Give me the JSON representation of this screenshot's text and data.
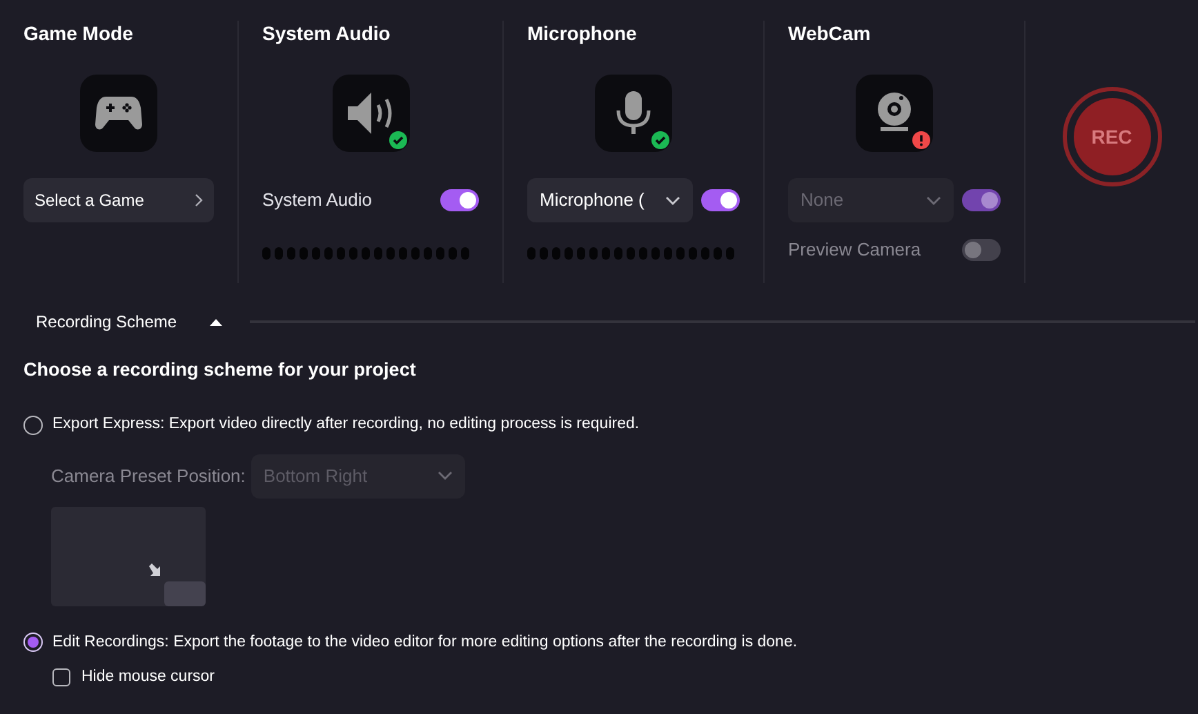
{
  "sources": [
    {
      "kind": "game",
      "title": "Game Mode",
      "button": "Select a Game"
    },
    {
      "kind": "audio",
      "title": "System Audio",
      "ready": true,
      "label": "System Audio",
      "on": true
    },
    {
      "kind": "mic",
      "title": "Microphone",
      "ready": true,
      "dropdown": "Microphone (",
      "on": true
    },
    {
      "kind": "webcam",
      "title": "WebCam",
      "ready": false,
      "dropdown": "None",
      "disabled": true,
      "on": true,
      "preview": {
        "label": "Preview Camera",
        "on": false
      }
    }
  ],
  "rec_button": {
    "label": "REC"
  },
  "scheme": {
    "tab": "Recording Scheme",
    "expanded": true,
    "heading": "Choose a recording scheme for your project",
    "options": [
      {
        "label": "Export Express: Export video directly after recording, no editing process is required.",
        "selected": false,
        "camera_preset": {
          "label": "Camera Preset Position:",
          "value": "Bottom Right",
          "disabled": true
        }
      },
      {
        "label": "Edit Recordings: Export the footage to the video editor for more editing options after the recording is done.",
        "selected": true,
        "checkbox": {
          "label": "Hide mouse cursor",
          "checked": false
        }
      }
    ]
  }
}
